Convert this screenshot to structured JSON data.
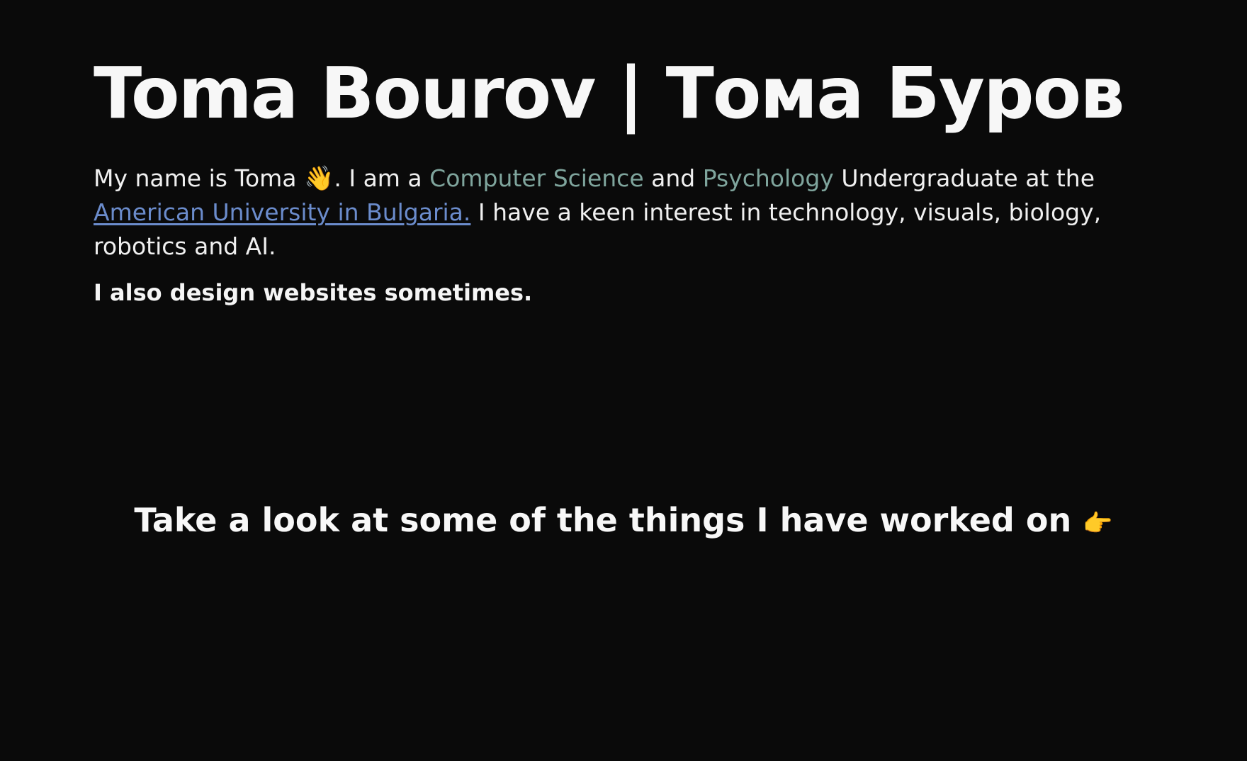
{
  "header": {
    "title": "Toma Bourov | Тома Буров"
  },
  "intro": {
    "part1": "My name is Toma ",
    "wave_emoji": "👋",
    "part2": ". I am a ",
    "field1": "Computer Science",
    "and": " and ",
    "field2": "Psychology",
    "part3": " Undergraduate at the ",
    "university_link": "American University in Bulgaria.",
    "part4": " I have a keen interest in technology, visuals, biology, robotics and AI."
  },
  "aside": {
    "text": "I also design websites sometimes."
  },
  "cta": {
    "text": "Take a look at some of the things I have worked on ",
    "pointer_emoji": "👉"
  },
  "colors": {
    "background": "#0a0a0a",
    "text": "#f2f2f2",
    "accent": "#7fa59d",
    "link": "#6b8ccc"
  }
}
